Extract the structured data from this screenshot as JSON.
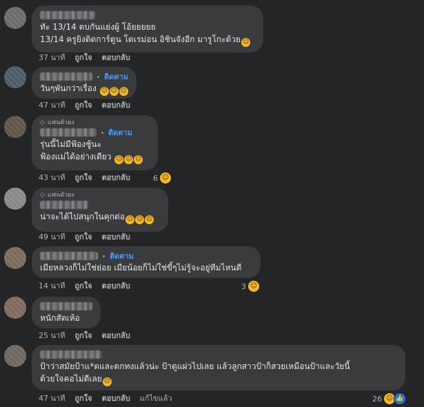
{
  "comments": [
    {
      "text_lines": [
        "ทัะ 13/14 ตบกันแย่งผู้ โอ้ยยยยย",
        "13/14 ครูยิงติดการ์ตูน โดเรม่อน อิชินจังอีก มารูโกะด้วย"
      ],
      "time": "37 นาที",
      "like": "ถูกใจ",
      "reply": "ตอบกลับ"
    },
    {
      "follow": "ติดตาม",
      "text_lines": [
        "วันๆพันกว่าเรื่อง"
      ],
      "time": "47 นาที",
      "like": "ถูกใจ",
      "reply": "ตอบกลับ"
    },
    {
      "badge": "แฟนตัวยง",
      "follow": "ติดตาม",
      "text_lines": [
        "รุ่นนี้ไม่มีฟ้องชู้นะ",
        "ฟ้องแม่ได้อย่างเดียว"
      ],
      "time": "43 นาที",
      "like": "ถูกใจ",
      "reply": "ตอบกลับ",
      "reaction_count": "6"
    },
    {
      "badge": "แฟนตัวยง",
      "text_lines": [
        "น่าจะได้ไปสนุกในคุกต่อ"
      ],
      "time": "49 นาที",
      "like": "ถูกใจ",
      "reply": "ตอบกลับ"
    },
    {
      "follow": "ติดตาม",
      "text_lines": [
        "เมียหลวงก็ไม่ใช่ย่อย เมียน้อยก็ไม่ใช่ขี้ๆไม่รู้จะอยู่ทีมไหนดี"
      ],
      "time": "14 นาที",
      "like": "ถูกใจ",
      "reply": "ตอบกลับ",
      "reaction_count": "3"
    },
    {
      "text_lines": [
        "หนักสัดเห้อ"
      ],
      "time": "25 นาที",
      "like": "ถูกใจ",
      "reply": "ตอบกลับ"
    },
    {
      "text_lines": [
        "ป้าว่าสมัยป้าแ*ดและดกทงแล้วน่ะ ป้าดูแผ่วไปเลย แล้วลูกสาวป้าก็สวยเหมือนป้าและวัยนี้",
        "ด้วยใจคอไม่ดีเลย"
      ],
      "time": "47 นาที",
      "like": "ถูกใจ",
      "reply": "ตอบกลับ",
      "edited": "แก้ไขแล้ว",
      "reaction_count": "26"
    }
  ],
  "colors": {
    "background": "#242526",
    "bubble": "#3a3b3c",
    "follow": "#4599ff",
    "emoji": "#f7b928",
    "like": "#1877f2"
  }
}
